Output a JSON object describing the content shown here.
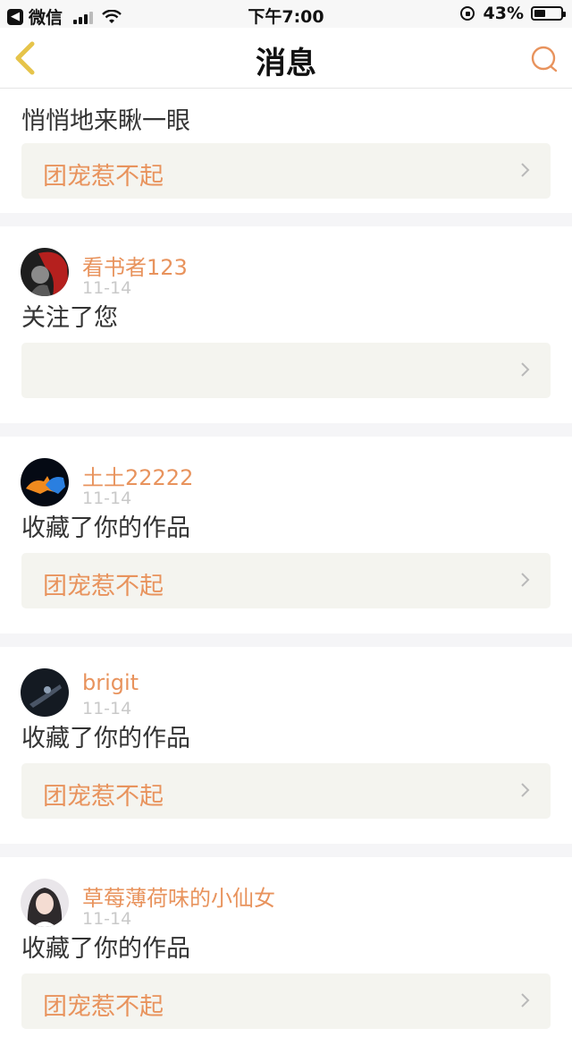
{
  "status_bar": {
    "back_app": "微信",
    "time": "下午7:00",
    "battery_text": "43%",
    "battery_level": 0.43
  },
  "nav": {
    "title": "消息",
    "back_icon": "chevron-left-icon",
    "search_icon": "search-icon"
  },
  "colors": {
    "accent": "#e8935d",
    "back_arrow": "#e6c44a",
    "card_bg": "#f4f4ef"
  },
  "items": [
    {
      "action": "悄悄地来瞅一眼",
      "work_title": "团宠惹不起"
    },
    {
      "username": "看书者123",
      "date": "11-14",
      "action": "关注了您",
      "work_title": ""
    },
    {
      "username": "土土22222",
      "date": "11-14",
      "action": "收藏了你的作品",
      "work_title": "团宠惹不起"
    },
    {
      "username": "brigit",
      "date": "11-14",
      "action": "收藏了你的作品",
      "work_title": "团宠惹不起"
    },
    {
      "username": "草莓薄荷味的小仙女",
      "date": "11-14",
      "action": "收藏了你的作品",
      "work_title": "团宠惹不起"
    }
  ]
}
